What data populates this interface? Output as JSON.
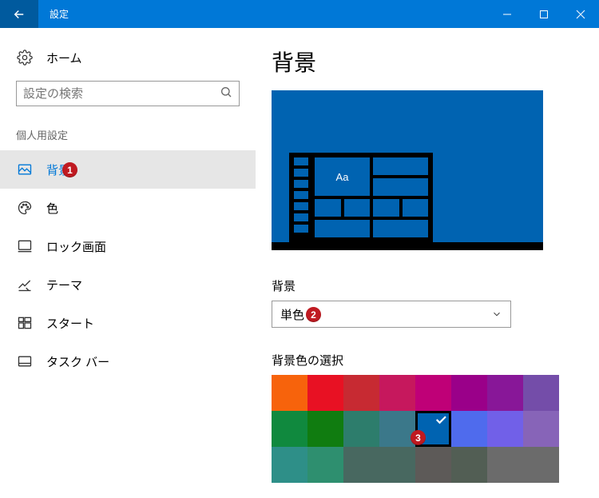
{
  "titlebar": {
    "title": "設定"
  },
  "sidebar": {
    "home_label": "ホーム",
    "search_placeholder": "設定の検索",
    "category_label": "個人用設定",
    "items": [
      {
        "label": "背景",
        "icon": "image-icon",
        "active": true
      },
      {
        "label": "色",
        "icon": "palette-icon",
        "active": false
      },
      {
        "label": "ロック画面",
        "icon": "lock-screen-icon",
        "active": false
      },
      {
        "label": "テーマ",
        "icon": "theme-icon",
        "active": false
      },
      {
        "label": "スタート",
        "icon": "start-icon",
        "active": false
      },
      {
        "label": "タスク バー",
        "icon": "taskbar-icon",
        "active": false
      }
    ]
  },
  "content": {
    "page_title": "背景",
    "preview_sample_text": "Aa",
    "background_label": "背景",
    "background_value": "単色",
    "color_section_label": "背景色の選択",
    "selected_color_index": 12,
    "swatches": [
      "#f7630c",
      "#e81123",
      "#c72a32",
      "#c6185d",
      "#bf0077",
      "#9a0089",
      "#881798",
      "#744da9",
      "#10893e",
      "#107c10",
      "#2d7d6c",
      "#3b788a",
      "#0063b1",
      "#4f6bed",
      "#7160e8",
      "#8764b8",
      "#2e8f88",
      "#2e8f6f",
      "#486860",
      "#486860",
      "#5d5a58",
      "#525e54",
      "#6b6b6b",
      "#6b6b6b"
    ]
  },
  "annotations": {
    "badge1": "1",
    "badge2": "2",
    "badge3": "3"
  }
}
